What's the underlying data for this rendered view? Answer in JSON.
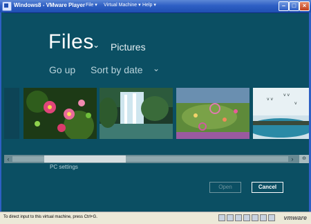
{
  "window": {
    "title": "Windows8 - VMware Player",
    "menus": [
      "File",
      "Virtual Machine",
      "Help"
    ]
  },
  "picker": {
    "location": "Files",
    "breadcrumb": "Pictures",
    "go_up": "Go up",
    "sort": "Sort by date",
    "pc_settings": "PC settings",
    "open_button": "Open",
    "cancel_button": "Cancel"
  },
  "statusbar": {
    "hint": "To direct input to this virtual machine, press Ctrl+G.",
    "brand": "vmware"
  },
  "icons": [
    "chevron-down-icon",
    "scroll-left-icon",
    "scroll-right-icon",
    "zoom-icon"
  ]
}
